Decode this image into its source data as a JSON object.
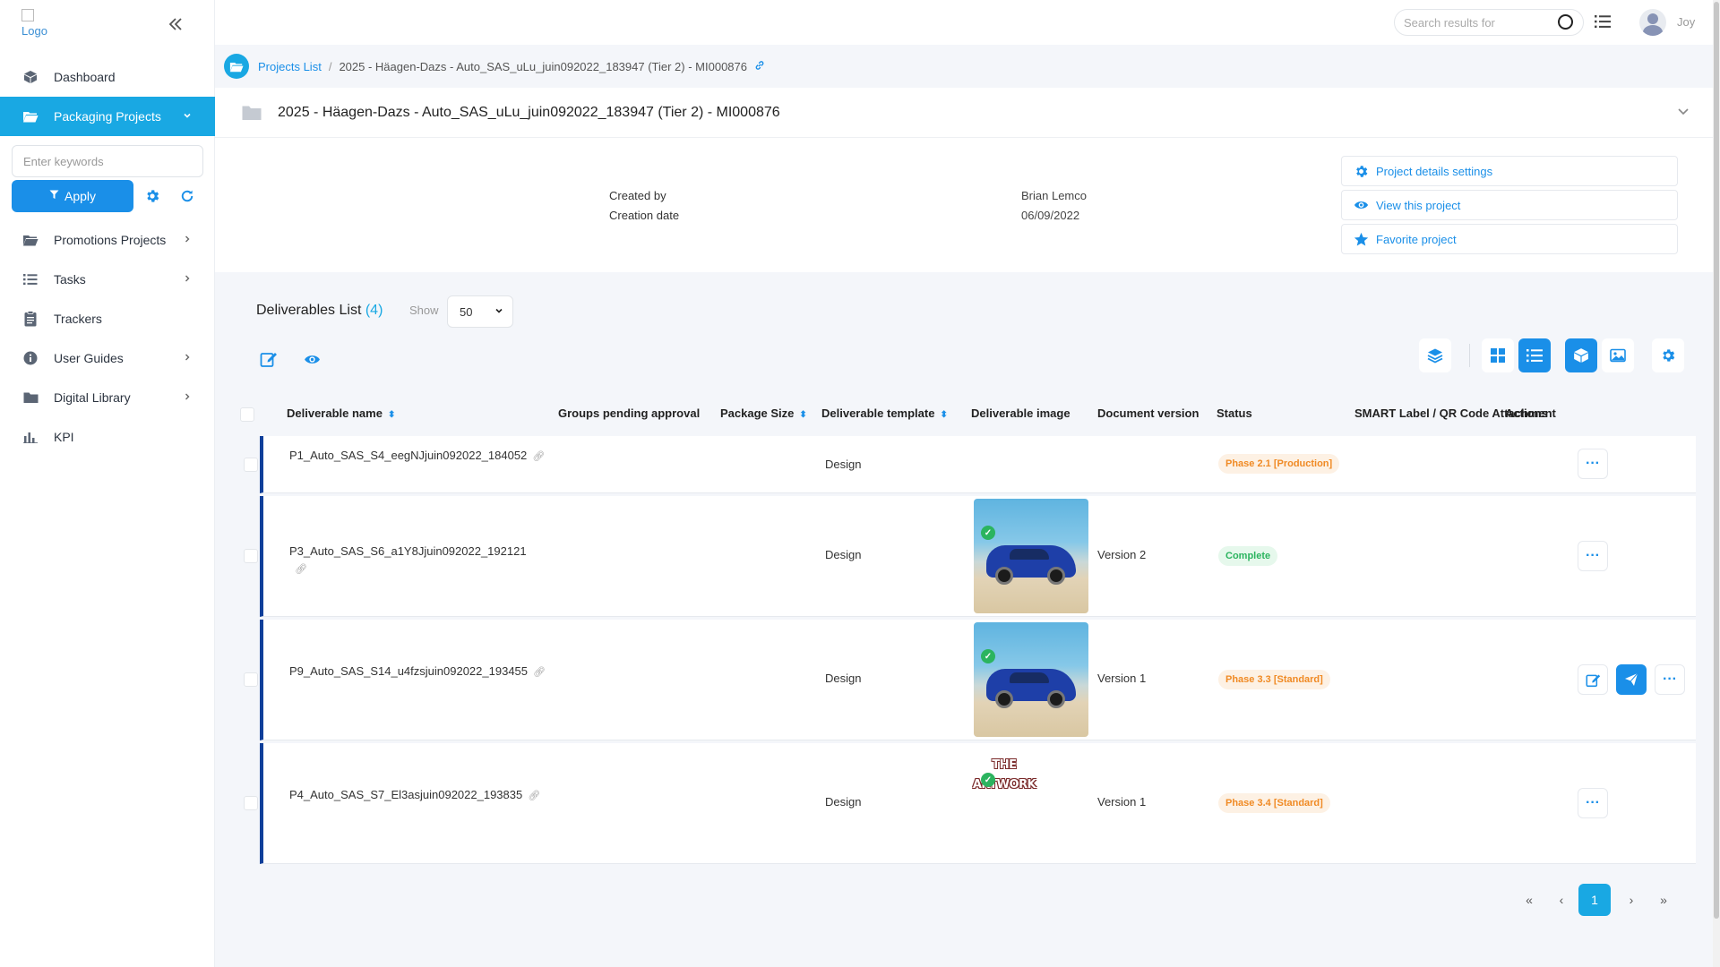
{
  "logo_alt": "Logo",
  "sidebar": {
    "items": [
      {
        "label": "Dashboard",
        "icon": "box-icon"
      },
      {
        "label": "Packaging Projects",
        "icon": "folder-open-icon",
        "active": true
      },
      {
        "label": "Promotions Projects",
        "icon": "folder-open-icon"
      },
      {
        "label": "Tasks",
        "icon": "list-icon"
      },
      {
        "label": "Trackers",
        "icon": "clipboard-icon"
      },
      {
        "label": "User Guides",
        "icon": "info-icon"
      },
      {
        "label": "Digital Library",
        "icon": "folder-icon"
      },
      {
        "label": "KPI",
        "icon": "bar-chart-icon"
      }
    ],
    "keyword_placeholder": "Enter keywords",
    "apply_label": "Apply"
  },
  "topbar": {
    "search_placeholder": "Search results for",
    "username": "Joy"
  },
  "breadcrumb": {
    "root": "Projects List",
    "current": "2025 - Häagen-Dazs - Auto_SAS_uLu_juin092022_183947 (Tier 2) - MI000876"
  },
  "project": {
    "title": "2025 - Häagen-Dazs - Auto_SAS_uLu_juin092022_183947 (Tier 2) - MI000876",
    "created_by_label": "Created by",
    "created_by": "Brian Lemco",
    "creation_date_label": "Creation date",
    "creation_date": "06/09/2022",
    "actions": [
      {
        "label": "Project details settings",
        "icon": "gear-icon"
      },
      {
        "label": "View this project",
        "icon": "eye-icon"
      },
      {
        "label": "Favorite project",
        "icon": "star-icon"
      }
    ]
  },
  "deliverables": {
    "title": "Deliverables List",
    "count_text": "(4)",
    "show_label": "Show",
    "page_size": "50",
    "columns": {
      "name": "Deliverable name",
      "groups": "Groups pending approval",
      "package_size": "Package Size",
      "template": "Deliverable template",
      "image": "Deliverable image",
      "doc_version": "Document version",
      "status": "Status",
      "smart": "SMART Label / QR Code Attachment",
      "actions": "Actions"
    },
    "rows": [
      {
        "name": "P1_Auto_SAS_S4_eegNJjuin092022_184052",
        "template": "Design",
        "image": "",
        "version": "",
        "status": "Phase 2.1 [Production]",
        "status_color": "#f08a24"
      },
      {
        "name": "P3_Auto_SAS_S6_a1Y8Jjuin092022_192121",
        "template": "Design",
        "image": "car-photo",
        "version": "Version 2",
        "status": "Complete",
        "status_color": "#2bb45f"
      },
      {
        "name": "P9_Auto_SAS_S14_u4fzsjuin092022_193455",
        "template": "Design",
        "image": "car-photo",
        "version": "Version 1",
        "status": "Phase 3.3 [Standard]",
        "status_color": "#f08a24"
      },
      {
        "name": "P4_Auto_SAS_S7_El3asjuin092022_193835",
        "template": "Design",
        "image": "artwork",
        "version": "Version 1",
        "status": "Phase 3.4 [Standard]",
        "status_color": "#f08a24"
      }
    ],
    "artwork_line1": "THE",
    "artwork_line2": "ARTWORK"
  },
  "pagination": {
    "first": "«",
    "prev": "‹",
    "current": "1",
    "next": "›",
    "last": "»"
  },
  "colors": {
    "accent": "#1a8fe8",
    "sidebar_active": "#19a8e3",
    "row_border": "#0f3f9a"
  }
}
